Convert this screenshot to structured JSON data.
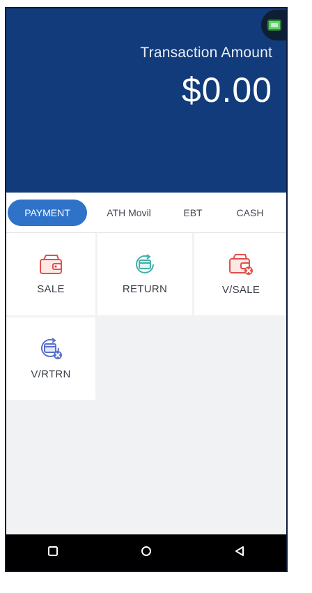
{
  "header": {
    "label": "Transaction Amount",
    "amount": "$0.00",
    "background": "#113b7a"
  },
  "tabs": [
    {
      "label": "PAYMENT",
      "active": true
    },
    {
      "label": "ATH Movil",
      "active": false
    },
    {
      "label": "EBT",
      "active": false
    },
    {
      "label": "CASH",
      "active": false
    }
  ],
  "tiles": [
    {
      "label": "SALE",
      "icon": "wallet-icon"
    },
    {
      "label": "RETURN",
      "icon": "card-return-icon"
    },
    {
      "label": "V/SALE",
      "icon": "wallet-void-icon"
    },
    {
      "label": "V/RTRN",
      "icon": "card-void-return-icon"
    }
  ],
  "colors": {
    "accent": "#2f73c9",
    "sale_icon": "#e0504a",
    "return_icon": "#3fb0a8",
    "void_return_icon": "#5a6fc9"
  },
  "navbar": {
    "icons": [
      "recent-apps-icon",
      "home-icon",
      "back-icon"
    ]
  }
}
